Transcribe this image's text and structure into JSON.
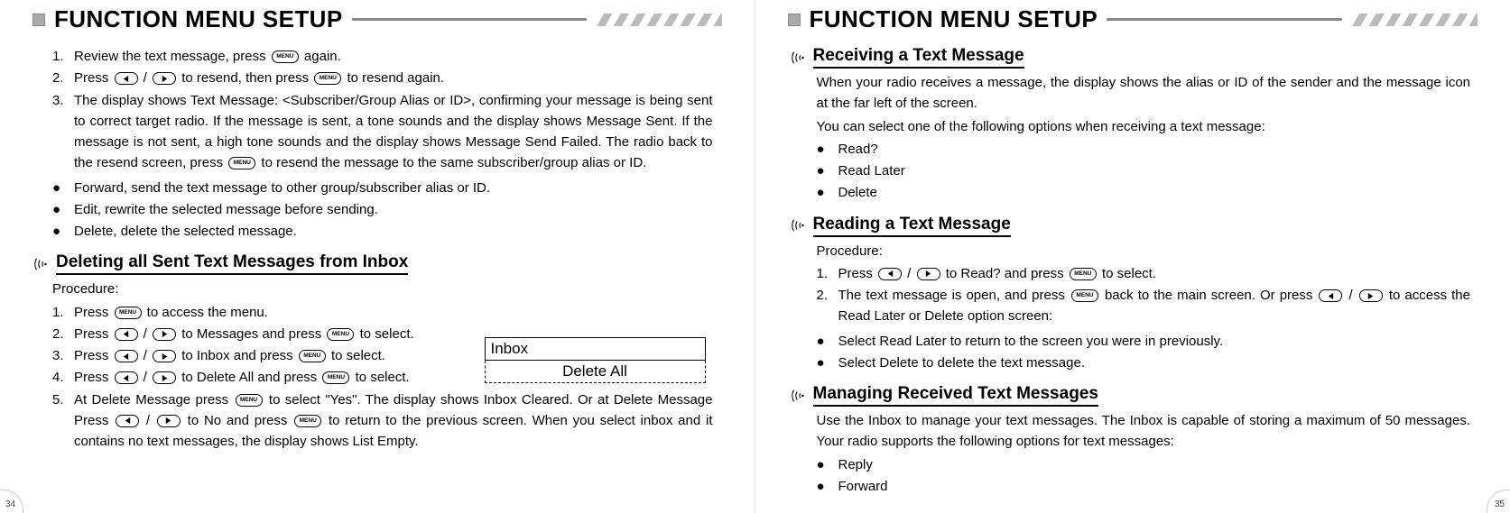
{
  "left": {
    "header": "FUNCTION MENU SETUP",
    "topNumbered": [
      {
        "n": "1.",
        "t": "Review the text message, press [MENU] again."
      },
      {
        "n": "2.",
        "t": "Press [LEFT / RIGHT] to resend, then press [MENU] to resend again."
      },
      {
        "n": "3.",
        "t": "The display shows Text Message: <Subscriber/Group Alias or ID>, confirming your message is being sent to correct target radio. If the message is sent, a tone sounds and the display shows Message Sent. If the message is not sent, a high tone sounds and the display shows Message Send Failed. The radio back to the resend screen, press [MENU] to resend the message to the same subscriber/group alias or ID."
      }
    ],
    "topBullets": [
      "Forward, send the text message to other group/subscriber alias or ID.",
      "Edit, rewrite the selected message before sending.",
      "Delete, delete the selected message."
    ],
    "section1Title": "Deleting all Sent Text Messages from Inbox",
    "procedureLabel": "Procedure:",
    "section1Numbered": [
      {
        "n": "1.",
        "t": "Press [MENU] to access the menu."
      },
      {
        "n": "2.",
        "t": "Press [LEFT / RIGHT] to Messages and press [MENU] to select."
      },
      {
        "n": "3.",
        "t": "Press [LEFT / RIGHT] to Inbox and press [MENU] to select."
      },
      {
        "n": "4.",
        "t": "Press [LEFT / RIGHT] to Delete All and press [MENU] to select."
      },
      {
        "n": "5.",
        "t": "At Delete Message press [MENU] to select \"Yes\". The display shows Inbox Cleared. Or at Delete Message Press [LEFT / RIGHT] to No and press [MENU] to return to the previous screen. When you select inbox and it contains no text messages, the display shows List Empty."
      }
    ],
    "screenTop": "Inbox",
    "screenBottom": "Delete All",
    "pageNum": "34"
  },
  "right": {
    "header": "FUNCTION MENU SETUP",
    "sectionATitle": "Receiving a Text Message",
    "sectionAParas": [
      "When your radio receives a message, the display shows the alias or ID of the sender and the message icon at the far left of the screen.",
      "You can select one of the following options when receiving a text message:"
    ],
    "sectionABullets": [
      "Read?",
      "Read Later",
      "Delete"
    ],
    "sectionBTitle": "Reading a Text Message",
    "procedureLabel": "Procedure:",
    "sectionBNumbered": [
      {
        "n": "1.",
        "t": "Press [LEFT / RIGHT] to Read? and press [MENU] to select."
      },
      {
        "n": "2.",
        "t": "The text message is open, and press [MENU] back to the main screen. Or press [LEFT / RIGHT] to access the Read Later or Delete option screen:"
      }
    ],
    "sectionBBullets": [
      "Select Read Later to return to the screen you were in previously.",
      "Select Delete to delete the text message."
    ],
    "sectionCTitle": "Managing Received Text Messages",
    "sectionCParas": [
      "Use the Inbox to manage your text messages. The Inbox is capable of storing a maximum of 50 messages. Your  radio  supports  the  following  options  for  text messages:"
    ],
    "sectionCBullets": [
      "Reply",
      "Forward"
    ],
    "pageNum": "35"
  },
  "keys": {
    "menu": "MENU"
  }
}
